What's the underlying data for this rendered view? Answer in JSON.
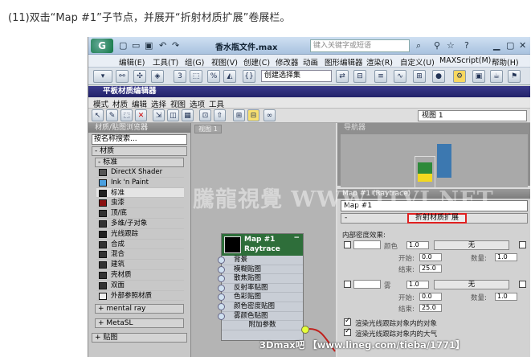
{
  "caption": "(11)双击“Map #1”子节点，并展开“折射材质扩展”卷展栏。",
  "app": {
    "doc_title": "香水瓶文件.max",
    "search_placeholder": "键入关键字或短语"
  },
  "menu": [
    "编辑(E)",
    "工具(T)",
    "组(G)",
    "视图(V)",
    "创建(C)",
    "修改器",
    "动画",
    "图形编辑器",
    "渲染(R)",
    "自定义(U)",
    "MAXScript(M)",
    "帮助(H)"
  ],
  "toolbar": {
    "selection_set": "创建选择集"
  },
  "editor": {
    "title": "平板材质编辑器",
    "menu": [
      "模式",
      "材质",
      "编辑",
      "选择",
      "视图",
      "选项",
      "工具"
    ],
    "view": "视图 1"
  },
  "browser": {
    "title": "材质/贴图浏览器",
    "search": "按名称搜索...",
    "group_material": "- 材质",
    "group_standard": "- 标准",
    "materials": [
      {
        "name": "DirectX Shader",
        "color": "#555"
      },
      {
        "name": "Ink 'n Paint",
        "color": "#4aa0e0"
      },
      {
        "name": "标准",
        "color": "#222"
      },
      {
        "name": "虫漆",
        "color": "#8a1010"
      },
      {
        "name": "顶/底",
        "color": "#333"
      },
      {
        "name": "多维/子对象",
        "color": "#333"
      },
      {
        "name": "光线跟踪",
        "color": "#222"
      },
      {
        "name": "合成",
        "color": "#333"
      },
      {
        "name": "混合",
        "color": "#333"
      },
      {
        "name": "建筑",
        "color": "#333"
      },
      {
        "name": "壳材质",
        "color": "#333"
      },
      {
        "name": "双面",
        "color": "#333"
      },
      {
        "name": "外部参照材质",
        "color": "#eee"
      }
    ],
    "group_mental_ray": "+ mental ray",
    "group_metasl": "+ MetaSL",
    "group_maps": "+ 贴图"
  },
  "canvas": {
    "tab": "视图 1"
  },
  "node": {
    "title": "Map #1",
    "type": "Raytrace",
    "slots": [
      "背景",
      "模糊贴图",
      "散焦贴图",
      "反射率贴图",
      "色彩贴图",
      "颜色密度贴图",
      "雾颜色贴图",
      "附加参数"
    ]
  },
  "navigator": {
    "title": "导航器"
  },
  "props": {
    "title": "Map #1 (Raytrace)",
    "map_name": "Map #1",
    "rollout": "折射材质扩展",
    "section": "内部密度效果:",
    "color_label": "颜色",
    "fog_label": "雾",
    "none": "无",
    "amount_1": "1.0",
    "amount_2": "1.0",
    "start_label": "开始:",
    "end_label": "结束:",
    "quantity_label": "数量:",
    "start_1": "0.0",
    "end_1": "25.0",
    "qty_1": "1.0",
    "start_2": "0.0",
    "end_2": "25.0",
    "qty_2": "1.0",
    "opt_1": "渲染光线跟踪对象内的对象",
    "opt_2": "渲染光线跟踪对象内的大气"
  },
  "watermark": "騰龍視覺 WWW.TLVI.NET",
  "forum": "3Dmax吧 【www.lineg.com/tieba/1771】"
}
